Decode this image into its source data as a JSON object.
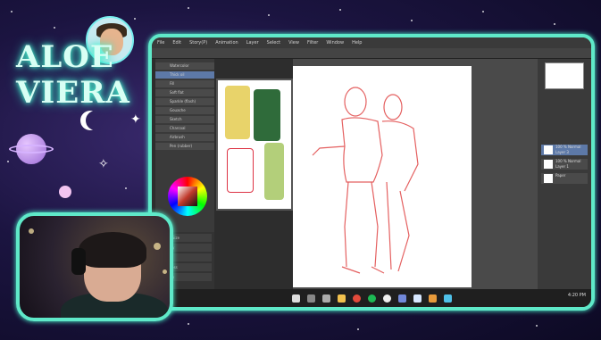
{
  "overlay": {
    "brand_line1": "ALOE",
    "brand_line2": "VIERA"
  },
  "app": {
    "menu": [
      "File",
      "Edit",
      "Story(P)",
      "Animation",
      "Layer",
      "Select",
      "View",
      "Filter",
      "Window",
      "Help"
    ],
    "brushes": [
      "Watercolor",
      "Thick oil",
      "Fill",
      "Soft flat",
      "Sparkle (flash)",
      "Gouache",
      "Sketch",
      "Charcoal",
      "Airbrush",
      "Pen (rubber)"
    ],
    "selected_brush_index": 1,
    "layer_property_rows": [
      "Brush Size",
      "Opacity",
      "Blend",
      "Hardness",
      "Density",
      "Stabilize"
    ],
    "layers": [
      {
        "name": "100 % Normal",
        "sub": "Layer 3",
        "selected": true
      },
      {
        "name": "100 % Normal",
        "sub": "Layer 1",
        "selected": false
      },
      {
        "name": "Paper",
        "sub": "",
        "selected": false
      }
    ],
    "clock": "4:20 PM"
  },
  "colors": {
    "accent": "#5fe9c9",
    "sketch": "#e04545",
    "selection": "#5d79a8"
  }
}
